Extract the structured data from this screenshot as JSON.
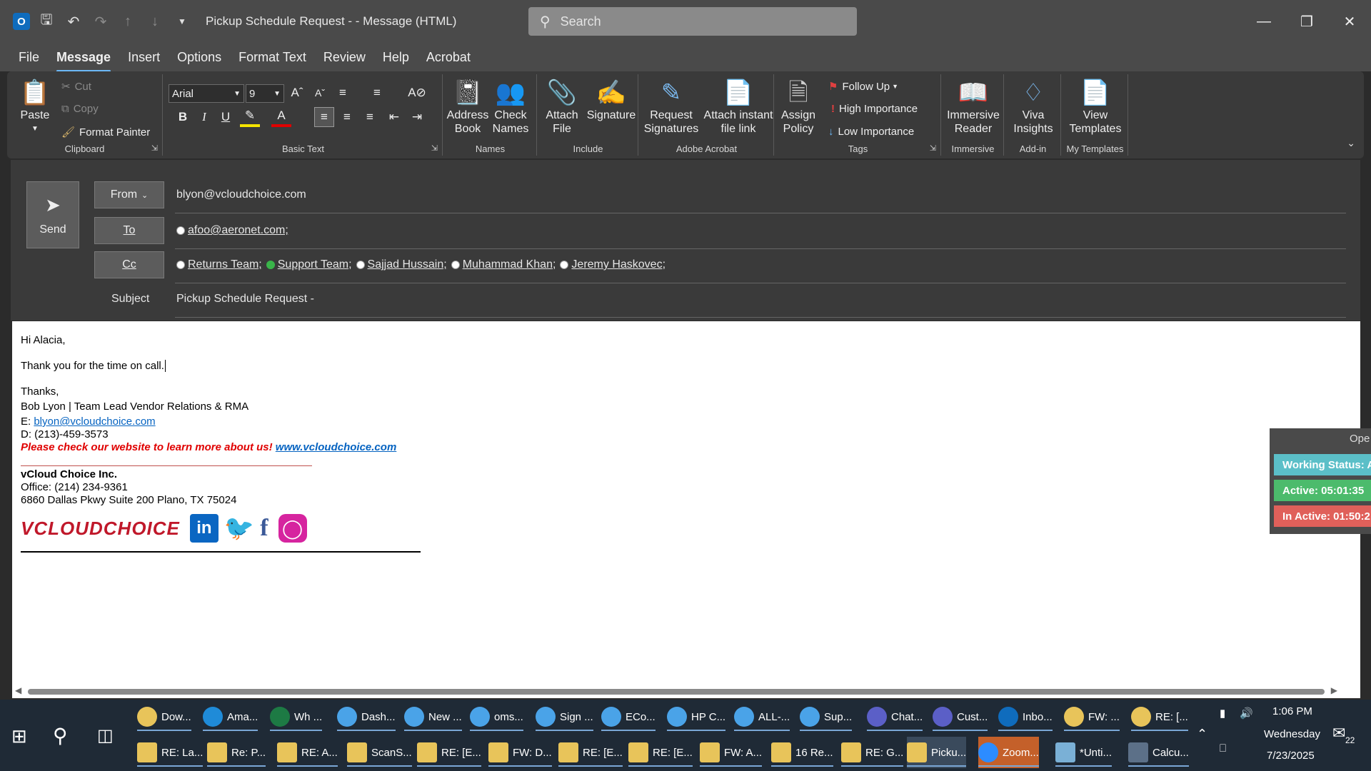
{
  "titlebar": {
    "title": "Pickup Schedule Request -  - Message (HTML)",
    "search_placeholder": "Search",
    "qat_icons": [
      "outlook-icon",
      "save-icon",
      "undo-icon",
      "redo-icon",
      "up-arrow-icon",
      "down-arrow-icon",
      "customize-qat-icon"
    ]
  },
  "menu": {
    "tabs": [
      "File",
      "Message",
      "Insert",
      "Options",
      "Format Text",
      "Review",
      "Help",
      "Acrobat"
    ],
    "active": "Message"
  },
  "ribbon": {
    "clipboard": {
      "paste": "Paste",
      "cut": "Cut",
      "copy": "Copy",
      "format_painter": "Format Painter",
      "label": "Clipboard"
    },
    "basic_text": {
      "font": "Arial",
      "size": "9",
      "label": "Basic Text"
    },
    "names": {
      "address_book": "Address Book",
      "check_names": "Check Names",
      "label": "Names"
    },
    "include": {
      "attach_file": "Attach File",
      "signature": "Signature",
      "label": "Include"
    },
    "acrobat": {
      "request_signatures": "Request Signatures",
      "attach_instant": "Attach instant file link",
      "label": "Adobe Acrobat"
    },
    "tags": {
      "assign_policy": "Assign Policy",
      "follow_up": "Follow Up",
      "high": "High Importance",
      "low": "Low Importance",
      "label": "Tags"
    },
    "immersive": {
      "reader": "Immersive Reader",
      "label": "Immersive"
    },
    "addin": {
      "viva": "Viva Insights",
      "label": "Add-in"
    },
    "templates": {
      "view": "View Templates",
      "label": "My Templates"
    }
  },
  "header": {
    "send": "Send",
    "from_label": "From",
    "from_value": "blyon@vcloudchoice.com",
    "to_label": "To",
    "to": [
      "afoo@aeronet.com;"
    ],
    "cc_label": "Cc",
    "cc": [
      "Returns Team;",
      "Support Team;",
      "Sajjad Hussain;",
      "Muhammad Khan;",
      "Jeremy Haskovec;"
    ],
    "subject_label": "Subject",
    "subject_value": "Pickup Schedule Request -"
  },
  "body": {
    "greeting": "Hi Alacia,",
    "line1": "Thank you for the time on call.",
    "thanks": "Thanks,",
    "sig_name": "Bob Lyon | Team Lead Vendor Relations & RMA",
    "email_prefix": "E: ",
    "email": "blyon@vcloudchoice.com",
    "phone": "D: (213)-459-3573",
    "promo": "Please check our website to learn more about us!",
    "website": "www.vcloudchoice.com",
    "company": "vCloud Choice Inc.",
    "office": "Office: (214) 234-9361",
    "address": "6860 Dallas Pkwy Suite 200 Plano, TX 75024",
    "logo_text": "VCLOUDCHOICE"
  },
  "status_panel": {
    "head": "Ope",
    "working": "Working Status: A",
    "active": "Active: 05:01:35",
    "inactive": "In Active: 01:50:2"
  },
  "taskbar": {
    "row1": [
      "Dow...",
      "Ama...",
      "Wh ...",
      "Dash...",
      "New ...",
      "oms...",
      "Sign ...",
      "ECo...",
      "HP C...",
      "ALL-...",
      "Sup...",
      "Chat...",
      "Cust...",
      "Inbo...",
      "FW: ...",
      "RE: [..."
    ],
    "row2": [
      "RE: La...",
      "Re: P...",
      "RE: A...",
      "ScanS...",
      "RE: [E...",
      "FW: D...",
      "RE: [E...",
      "RE: [E...",
      "FW: A...",
      "16 Re...",
      "RE: G...",
      "Picku...",
      "Zoom...",
      "*Unti...",
      "Calcu..."
    ],
    "time": "1:06 PM",
    "day": "Wednesday",
    "date": "7/23/2025",
    "notif_count": "22"
  },
  "colors": {
    "accent": "#6cb8f6",
    "red": "#e00000",
    "link": "#0563c1",
    "working": "#5bbfc8",
    "active": "#4cbb6c",
    "inactive": "#e0605a"
  }
}
